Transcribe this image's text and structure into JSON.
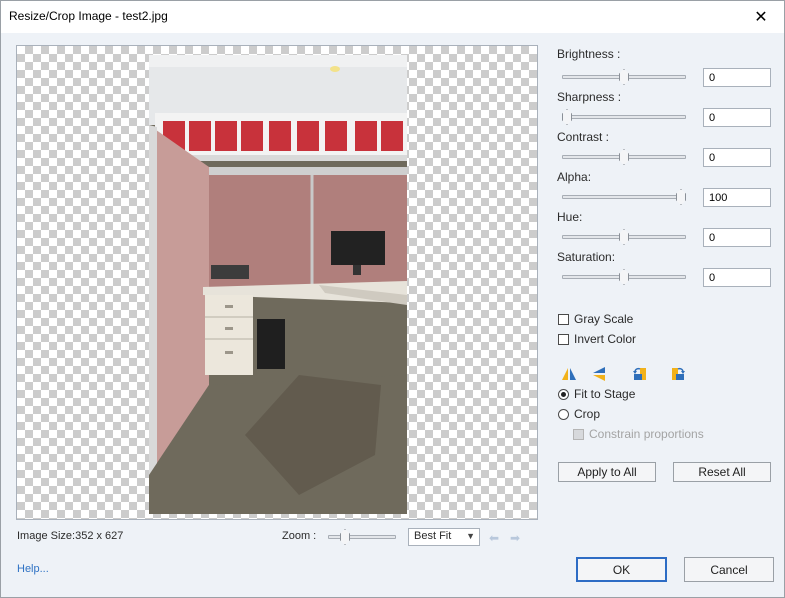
{
  "window": {
    "title": "Resize/Crop Image - test2.jpg",
    "close_glyph": "✕"
  },
  "controls": {
    "brightness": {
      "label": "Brightness :",
      "value": "0",
      "level": 0.5
    },
    "sharpness": {
      "label": "Sharpness :",
      "value": "0",
      "level": 0.0
    },
    "contrast": {
      "label": "Contrast :",
      "value": "0",
      "level": 0.5
    },
    "alpha": {
      "label": "Alpha:",
      "value": "100",
      "level": 1.0
    },
    "hue": {
      "label": "Hue:",
      "value": "0",
      "level": 0.5
    },
    "saturation": {
      "label": "Saturation:",
      "value": "0",
      "level": 0.5
    }
  },
  "options": {
    "gray_scale": "Gray Scale",
    "invert_color": "Invert Color",
    "fit_to_stage": "Fit to Stage",
    "crop": "Crop",
    "constrain_proportions": "Constrain proportions"
  },
  "tools": {
    "flip_horizontal": "flip-horizontal-icon",
    "flip_vertical": "flip-vertical-icon",
    "rotate_left": "rotate-left-icon",
    "rotate_right": "rotate-right-icon"
  },
  "buttons": {
    "apply_to_all": "Apply to All",
    "reset_all": "Reset All",
    "ok": "OK",
    "cancel": "Cancel"
  },
  "footer": {
    "image_size": "Image Size:352 x 627",
    "zoom_label": "Zoom :",
    "zoom_value": "Best Fit",
    "zoom_level": 0.2,
    "help": "Help..."
  },
  "colors": {
    "accent": "#2d6cc4",
    "link": "#2f72c4",
    "flip_yellow": "#f2b21a",
    "flip_blue": "#2f6fba"
  }
}
